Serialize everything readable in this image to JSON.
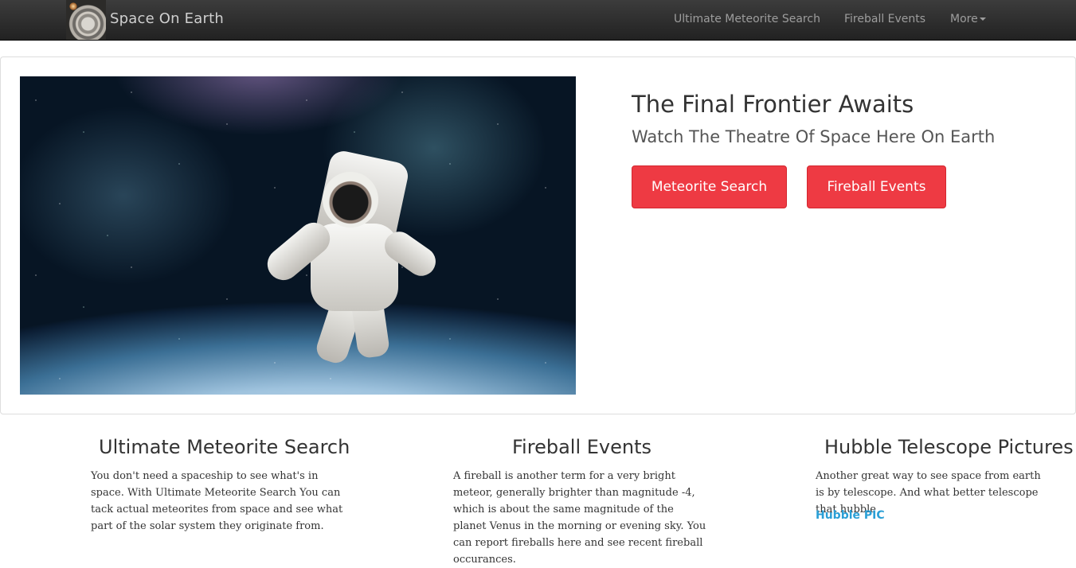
{
  "navbar": {
    "brand": "Space On Earth",
    "links": [
      "Ultimate Meteorite Search",
      "Fireball Events",
      "More"
    ]
  },
  "hero": {
    "title": "The Final Frontier Awaits",
    "subtitle": "Watch The Theatre Of Space Here On Earth",
    "button1": "Meteorite Search",
    "button2": "Fireball Events"
  },
  "columns": [
    {
      "title": "Ultimate Meteorite Search",
      "text": "You don't need a spaceship to see what's in space. With Ultimate Meteorite Search You can tack actual meteorites from space and see what part of the solar system they originate from."
    },
    {
      "title": "Fireball Events",
      "text": "A fireball is another term for a very bright meteor, generally brighter than magnitude -4, which is about the same magnitude of the planet Venus in the morning or evening sky. You can report fireballs here and see recent fireball occurances."
    },
    {
      "title": "Hubble Telescope Pictures",
      "text": "Another great way to see space from earth is by telescope. And what better telescope that hubble",
      "link": "Hubble PIC"
    }
  ],
  "colors": {
    "accent": "#ee3a43",
    "link": "#2a9fd6",
    "navbar": "#222222"
  }
}
